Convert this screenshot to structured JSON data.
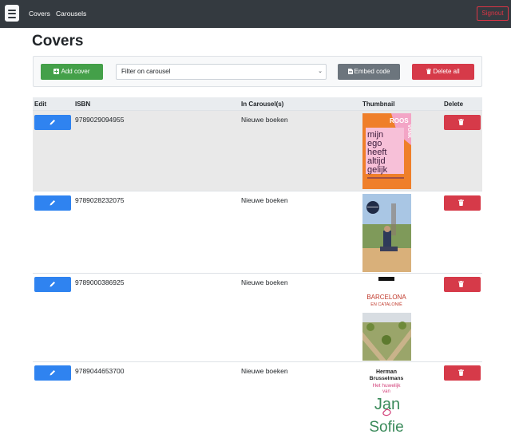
{
  "nav": {
    "links": [
      "Covers",
      "Carousels"
    ],
    "signout": "Signout"
  },
  "page": {
    "title": "Covers"
  },
  "toolbar": {
    "add_cover": "Add cover",
    "filter_placeholder": "Filter on carousel",
    "embed_code": "Embed code",
    "delete_all": "Delete all"
  },
  "table": {
    "headers": [
      "Edit",
      "ISBN",
      "In Carousel(s)",
      "Thumbnail",
      "Delete"
    ],
    "rows": [
      {
        "isbn": "9789029094955",
        "carousel": "Nieuwe boeken",
        "cover": {
          "author": "ROOS",
          "author2": "VONK",
          "title_lines": [
            "mijn",
            "ego",
            "heeft",
            "altijd",
            "gelijk"
          ]
        }
      },
      {
        "isbn": "9789028232075",
        "carousel": "Nieuwe boeken",
        "cover": {}
      },
      {
        "isbn": "9789000386925",
        "carousel": "Nieuwe boeken",
        "cover": {
          "title": "BARCELONA",
          "subtitle": "EN CATALONIË"
        }
      },
      {
        "isbn": "9789044653700",
        "carousel": "Nieuwe boeken",
        "cover": {
          "author_first": "Herman",
          "author_last": "Brusselmans",
          "title_lines": [
            "Het huwelijk",
            "van",
            "Jan",
            "Sofie"
          ]
        }
      }
    ]
  },
  "colors": {
    "navbar": "#343a40",
    "success": "#28a745",
    "secondary": "#6c757d",
    "danger": "#dc3545",
    "primary": "#2f83f0"
  }
}
